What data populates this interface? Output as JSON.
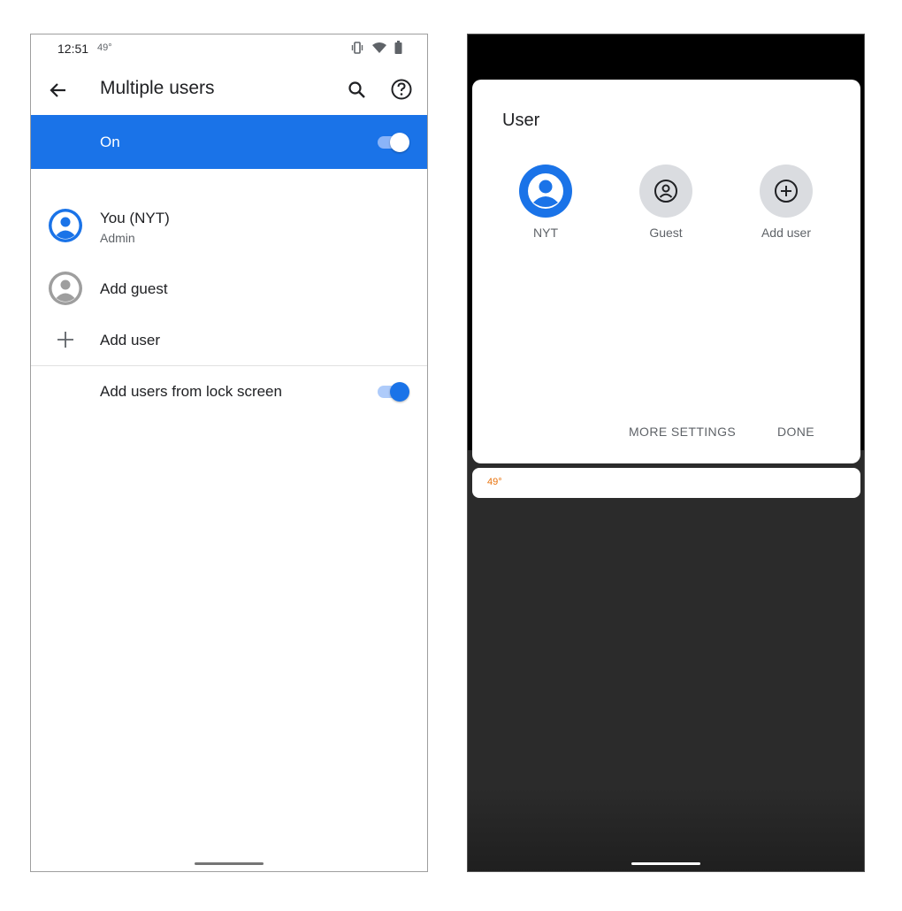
{
  "left_phone": {
    "status_bar": {
      "time": "12:51",
      "temperature": "49°",
      "icons": [
        "vibrate-icon",
        "wifi-icon",
        "battery-icon"
      ]
    },
    "app_bar": {
      "title": "Multiple users",
      "icons": [
        "back-arrow-icon",
        "search-icon",
        "help-icon"
      ]
    },
    "master_switch": {
      "label": "On",
      "checked": true
    },
    "users": [
      {
        "name": "You (NYT)",
        "role": "Admin",
        "icon": "account-circle-icon"
      }
    ],
    "actions": {
      "add_guest": {
        "label": "Add guest",
        "icon": "guest-avatar-icon"
      },
      "add_user": {
        "label": "Add user",
        "icon": "plus-icon"
      }
    },
    "lock_screen_setting": {
      "label": "Add users from lock screen",
      "checked": true
    }
  },
  "right_phone": {
    "dialog": {
      "title": "User",
      "tiles": [
        {
          "label": "NYT",
          "icon": "account-circle-icon"
        },
        {
          "label": "Guest",
          "icon": "guest-face-icon"
        },
        {
          "label": "Add user",
          "icon": "add-circle-icon"
        }
      ],
      "more_settings_label": "MORE SETTINGS",
      "done_label": "DONE"
    },
    "notification": {
      "temperature": "49°"
    }
  },
  "colors": {
    "accent": "#1a73e8",
    "accent_light": "#8ab4f8",
    "text_primary": "#202124",
    "text_secondary": "#5f6368",
    "guest_circle": "#dadce0",
    "temperature_orange": "#e8710a",
    "shade": "#2b2b2b"
  }
}
